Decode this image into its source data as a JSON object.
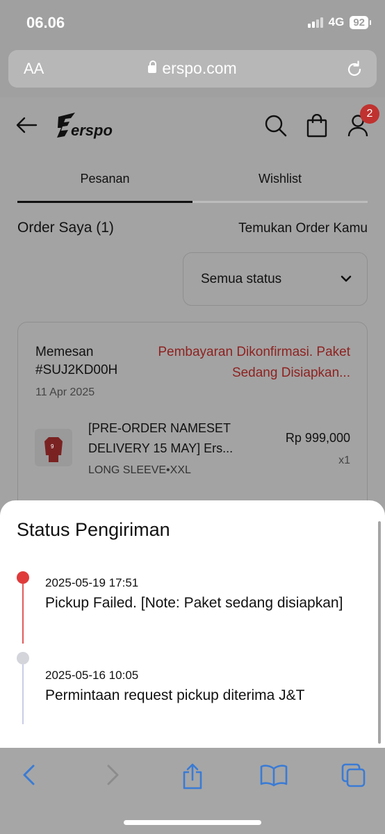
{
  "statusbar": {
    "time": "06.06",
    "network": "4G",
    "battery": "92"
  },
  "browser": {
    "text_size": "AA",
    "url": "erspo.com"
  },
  "header": {
    "brand": "erspo",
    "cart_badge": "2"
  },
  "tabs": [
    {
      "label": "Pesanan"
    },
    {
      "label": "Wishlist"
    }
  ],
  "orders": {
    "title": "Order Saya (1)",
    "find_label": "Temukan Order Kamu",
    "status_filter": "Semua status"
  },
  "order_card": {
    "label": "Memesan",
    "id": "#SUJ2KD00H",
    "date": "11 Apr 2025",
    "status": "Pembayaran Dikonfirmasi. Paket Sedang Disiapkan...",
    "product": {
      "name": "[PRE-ORDER NAMESET DELIVERY 15 MAY] Ers...",
      "variant": "LONG SLEEVE•XXL",
      "price": "Rp 999,000",
      "qty": "x1"
    }
  },
  "shipping_sheet": {
    "title": "Status Pengiriman",
    "events": [
      {
        "timestamp": "2025-05-19 17:51",
        "message": "Pickup Failed. [Note: Paket sedang disiapkan]"
      },
      {
        "timestamp": "2025-05-16 10:05",
        "message": "Permintaan request pickup diterima J&T"
      }
    ]
  },
  "colors": {
    "accent_red": "#e03b3b",
    "status_red": "#8e2220",
    "toolbar_blue": "#3a7bd5"
  }
}
